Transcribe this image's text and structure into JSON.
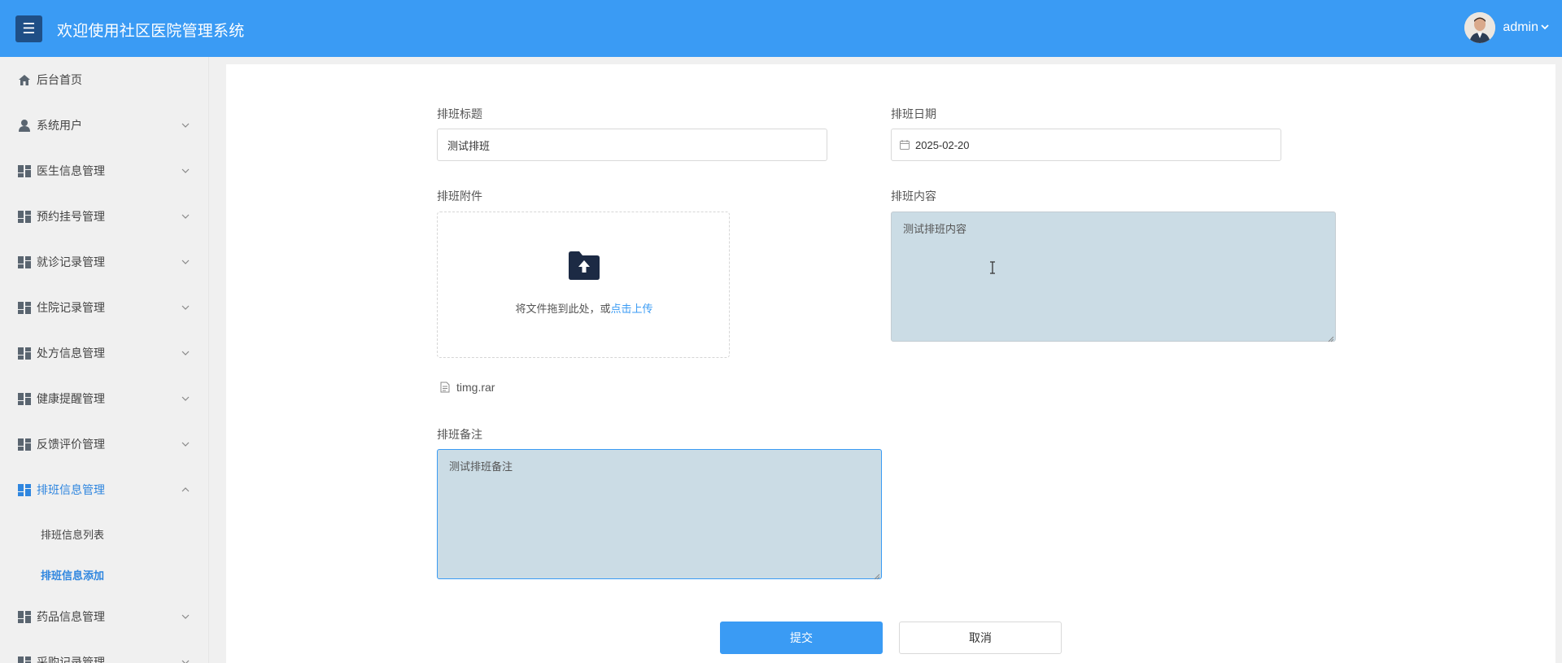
{
  "header": {
    "menu_icon": "☰",
    "title": "欢迎使用社区医院管理系统",
    "username": "admin",
    "dropdown_icon": "⌄"
  },
  "sidebar": {
    "items": [
      {
        "label": "后台首页",
        "icon": "home-icon"
      },
      {
        "label": "系统用户",
        "icon": "user-icon"
      },
      {
        "label": "医生信息管理",
        "icon": "grid-icon"
      },
      {
        "label": "预约挂号管理",
        "icon": "grid-icon"
      },
      {
        "label": "就诊记录管理",
        "icon": "grid-icon"
      },
      {
        "label": "住院记录管理",
        "icon": "grid-icon"
      },
      {
        "label": "处方信息管理",
        "icon": "grid-icon"
      },
      {
        "label": "健康提醒管理",
        "icon": "grid-icon"
      },
      {
        "label": "反馈评价管理",
        "icon": "grid-icon"
      },
      {
        "label": "排班信息管理",
        "icon": "grid-icon",
        "active": true
      },
      {
        "label": "药品信息管理",
        "icon": "grid-icon"
      },
      {
        "label": "采购记录管理",
        "icon": "grid-icon"
      }
    ],
    "sub_items": [
      {
        "label": "排班信息列表"
      },
      {
        "label": "排班信息添加",
        "active": true
      }
    ]
  },
  "form": {
    "title_label": "排班标题",
    "title_value": "测试排班",
    "date_label": "排班日期",
    "date_value": "2025-02-20",
    "attachment_label": "排班附件",
    "upload_prompt": "将文件拖到此处，或",
    "upload_link": "点击上传",
    "attachment_file": "timg.rar",
    "content_label": "排班内容",
    "content_value": "测试排班内容",
    "remark_label": "排班备注",
    "remark_value": "测试排班备注",
    "submit_label": "提交",
    "cancel_label": "取消"
  },
  "colors": {
    "header_bg": "#3a9bf4",
    "accent": "#2f86df",
    "textarea_bg": "#cbdce5"
  }
}
